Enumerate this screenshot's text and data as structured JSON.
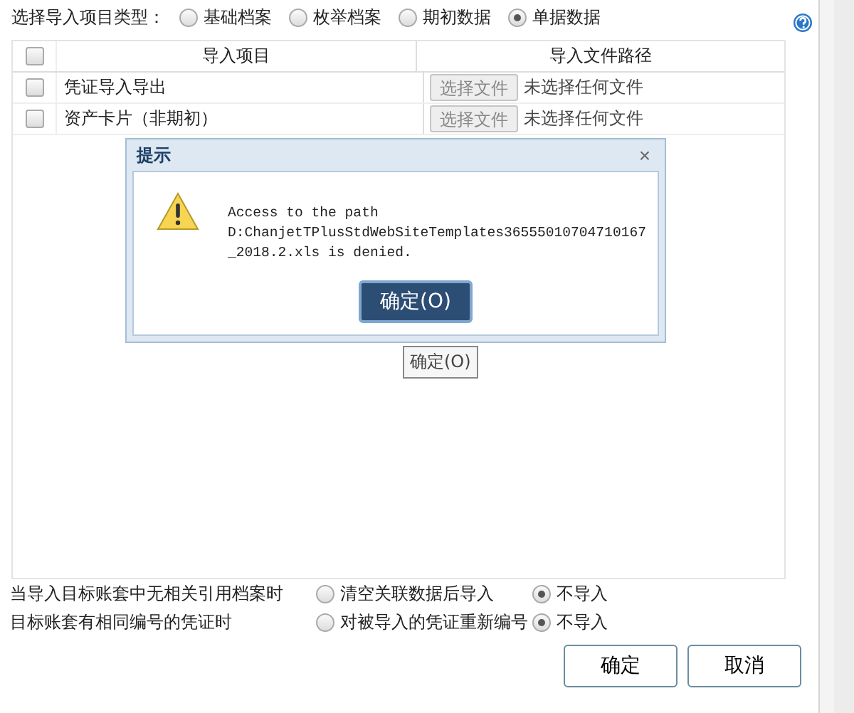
{
  "type_prompt": "选择导入项目类型：",
  "types": [
    {
      "label": "基础档案",
      "selected": false
    },
    {
      "label": "枚举档案",
      "selected": false
    },
    {
      "label": "期初数据",
      "selected": false
    },
    {
      "label": "单据数据",
      "selected": true
    }
  ],
  "table": {
    "header_checked": false,
    "columns": [
      "导入项目",
      "导入文件路径"
    ],
    "rows": [
      {
        "checked": false,
        "item": "凭证导入导出",
        "button": "选择文件",
        "file": "未选择任何文件"
      },
      {
        "checked": false,
        "item": "资产卡片（非期初）",
        "button": "选择文件",
        "file": "未选择任何文件"
      }
    ]
  },
  "dialog": {
    "title": "提示",
    "close": "×",
    "message": "Access to the path D:ChanjetTPlusStdWebSiteTemplates36555010704710167_2018.2.xls is denied.",
    "ok": "确定(O)",
    "tooltip": "确定(O)"
  },
  "options": [
    {
      "label": "当导入目标账套中无相关引用档案时",
      "choices": [
        {
          "label": "清空关联数据后导入",
          "selected": false
        },
        {
          "label": "不导入",
          "selected": true
        }
      ]
    },
    {
      "label": "目标账套有相同编号的凭证时",
      "choices": [
        {
          "label": "对被导入的凭证重新编号",
          "selected": false
        },
        {
          "label": "不导入",
          "selected": true
        }
      ]
    }
  ],
  "buttons": [
    "确定",
    "取消"
  ]
}
